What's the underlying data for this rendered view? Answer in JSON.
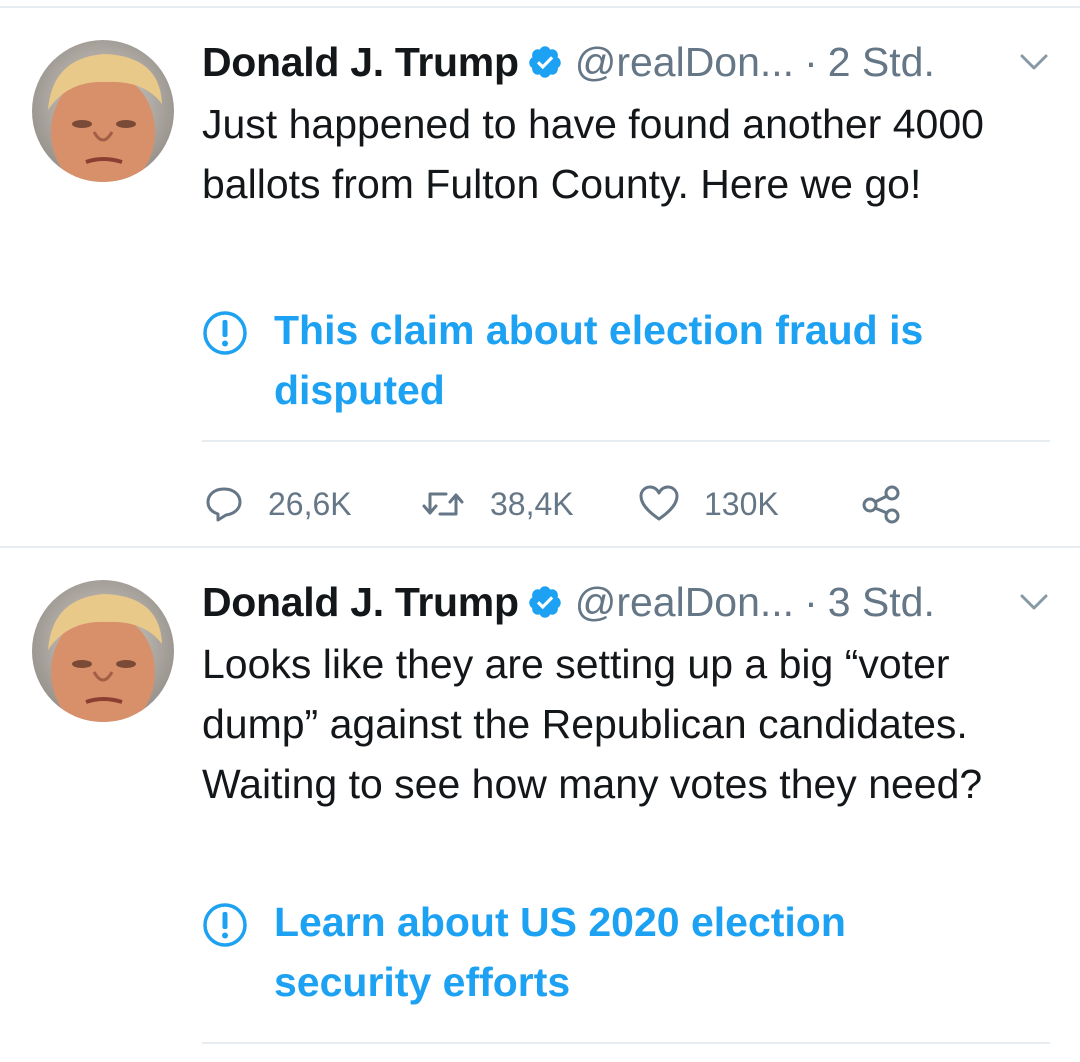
{
  "tweets": [
    {
      "author_name": "Donald J. Trump",
      "handle": "@realDon...",
      "time": "2 Std.",
      "text": "Just happened to have found another 4000 ballots from Fulton County. Here we go!",
      "notice": "This claim about election fraud is disputed",
      "stats": {
        "replies": "26,6K",
        "retweets": "38,4K",
        "likes": "130K"
      }
    },
    {
      "author_name": "Donald J. Trump",
      "handle": "@realDon...",
      "time": "3 Std.",
      "text": "Looks like they are setting up a big “voter dump” against the Republican candidates. Waiting to see how many votes they need?",
      "notice": "Learn about US 2020 election security efforts"
    }
  ],
  "separator": "·",
  "colors": {
    "accent": "#1da1f2",
    "muted": "#657786",
    "divider": "#e6ecf0",
    "text": "#14171a"
  },
  "icons": [
    "verified-badge-icon",
    "chevron-down-icon",
    "info-circle-icon",
    "reply-icon",
    "retweet-icon",
    "like-icon",
    "share-icon"
  ]
}
